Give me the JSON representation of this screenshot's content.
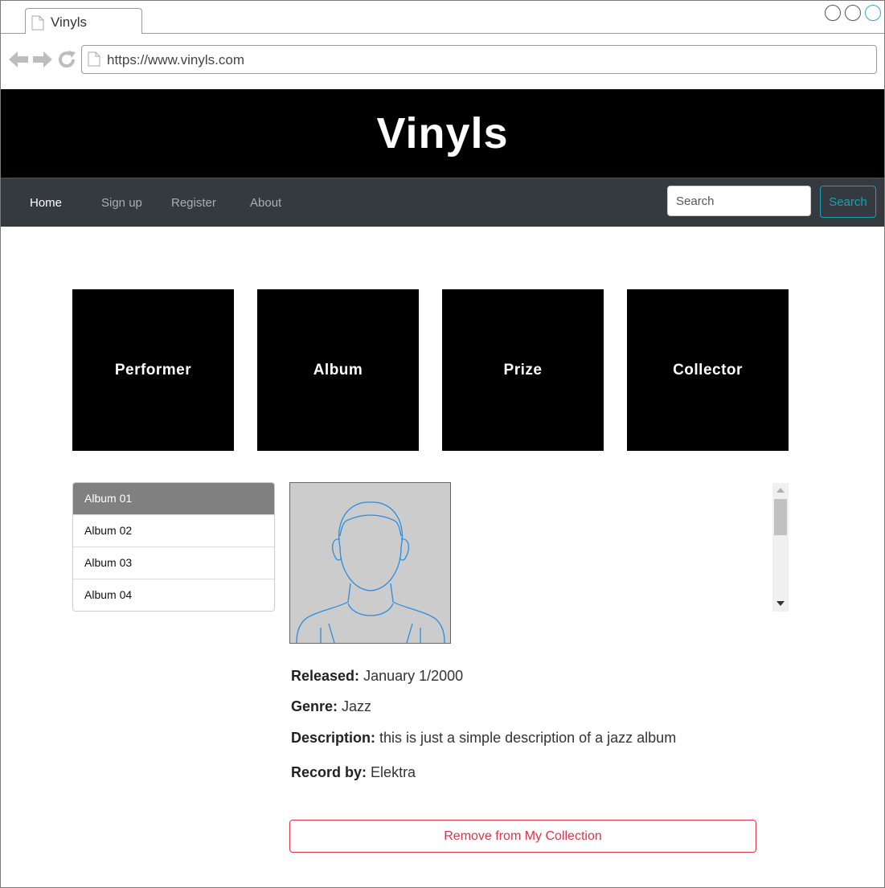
{
  "browser": {
    "tab_title": "Vinyls",
    "url": "https://www.vinyls.com"
  },
  "header": {
    "title": "Vinyls"
  },
  "nav": {
    "links": [
      "Home",
      "Sign up",
      "Register",
      "About"
    ],
    "search_placeholder": "Search",
    "search_button": "Search"
  },
  "categories": [
    "Performer",
    "Album",
    "Prize",
    "Collector"
  ],
  "albums": [
    "Album 01",
    "Album 02",
    "Album 03",
    "Album 04"
  ],
  "selected_album_index": 0,
  "details": {
    "released_label": "Released:",
    "released_value": "January 1/2000",
    "genre_label": "Genre:",
    "genre_value": "Jazz",
    "description_label": "Description:",
    "description_value": "this is just a simple description of a jazz album",
    "record_label": "Record by:",
    "record_value": "Elektra"
  },
  "actions": {
    "remove_label": "Remove from My Collection"
  },
  "colors": {
    "accent_info": "#17a2b8",
    "danger": "#dc3545",
    "navbar": "#343a40",
    "header": "#000000"
  }
}
